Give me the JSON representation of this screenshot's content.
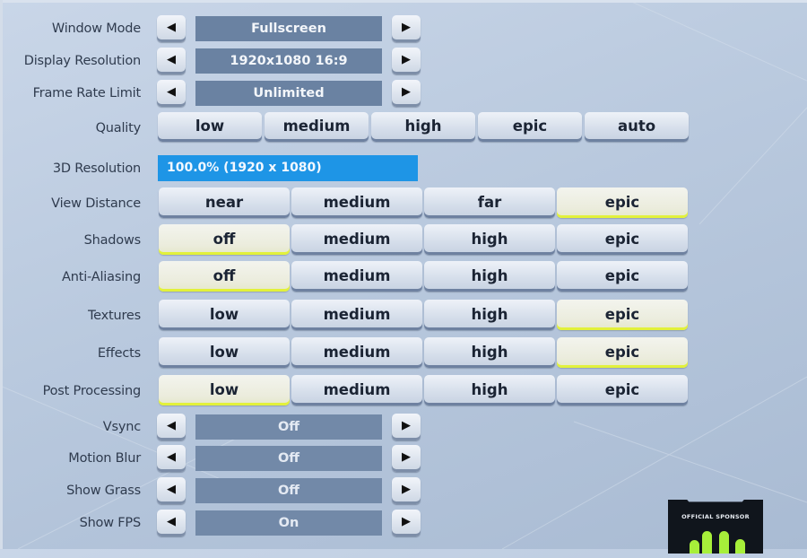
{
  "window_mode": {
    "label": "Window Mode",
    "value": "Fullscreen",
    "prev_icon": "◀",
    "next_icon": "▶"
  },
  "display_resolution": {
    "label": "Display Resolution",
    "value": "1920x1080 16:9",
    "prev_icon": "◀",
    "next_icon": "▶"
  },
  "frame_rate_limit": {
    "label": "Frame Rate Limit",
    "value": "Unlimited",
    "prev_icon": "◀",
    "next_icon": "▶"
  },
  "quality": {
    "label": "Quality",
    "options": [
      "low",
      "medium",
      "high",
      "epic",
      "auto"
    ],
    "selected": null
  },
  "resolution_3d": {
    "label": "3D Resolution",
    "value": "100.0%  (1920 x 1080)",
    "percent": 100.0
  },
  "view_distance": {
    "label": "View Distance",
    "options": [
      "near",
      "medium",
      "far",
      "epic"
    ],
    "selected": "epic"
  },
  "shadows": {
    "label": "Shadows",
    "options": [
      "off",
      "medium",
      "high",
      "epic"
    ],
    "selected": "off"
  },
  "anti_aliasing": {
    "label": "Anti-Aliasing",
    "options": [
      "off",
      "medium",
      "high",
      "epic"
    ],
    "selected": "off"
  },
  "textures": {
    "label": "Textures",
    "options": [
      "low",
      "medium",
      "high",
      "epic"
    ],
    "selected": "epic"
  },
  "effects": {
    "label": "Effects",
    "options": [
      "low",
      "medium",
      "high",
      "epic"
    ],
    "selected": "epic"
  },
  "post_processing": {
    "label": "Post Processing",
    "options": [
      "low",
      "medium",
      "high",
      "epic"
    ],
    "selected": "low"
  },
  "vsync": {
    "label": "Vsync",
    "value": "Off",
    "prev_icon": "◀",
    "next_icon": "▶"
  },
  "motion_blur": {
    "label": "Motion Blur",
    "value": "Off",
    "prev_icon": "◀",
    "next_icon": "▶"
  },
  "show_grass": {
    "label": "Show Grass",
    "value": "Off",
    "prev_icon": "◀",
    "next_icon": "▶"
  },
  "show_fps": {
    "label": "Show FPS",
    "value": "On",
    "prev_icon": "◀",
    "next_icon": "▶"
  },
  "sponsor": {
    "text": "OFFICIAL SPONSOR"
  },
  "colors": {
    "selected_accent": "#e2f13a",
    "resolution_bar": "#1e95e6",
    "value_box": "#6a82a2"
  }
}
